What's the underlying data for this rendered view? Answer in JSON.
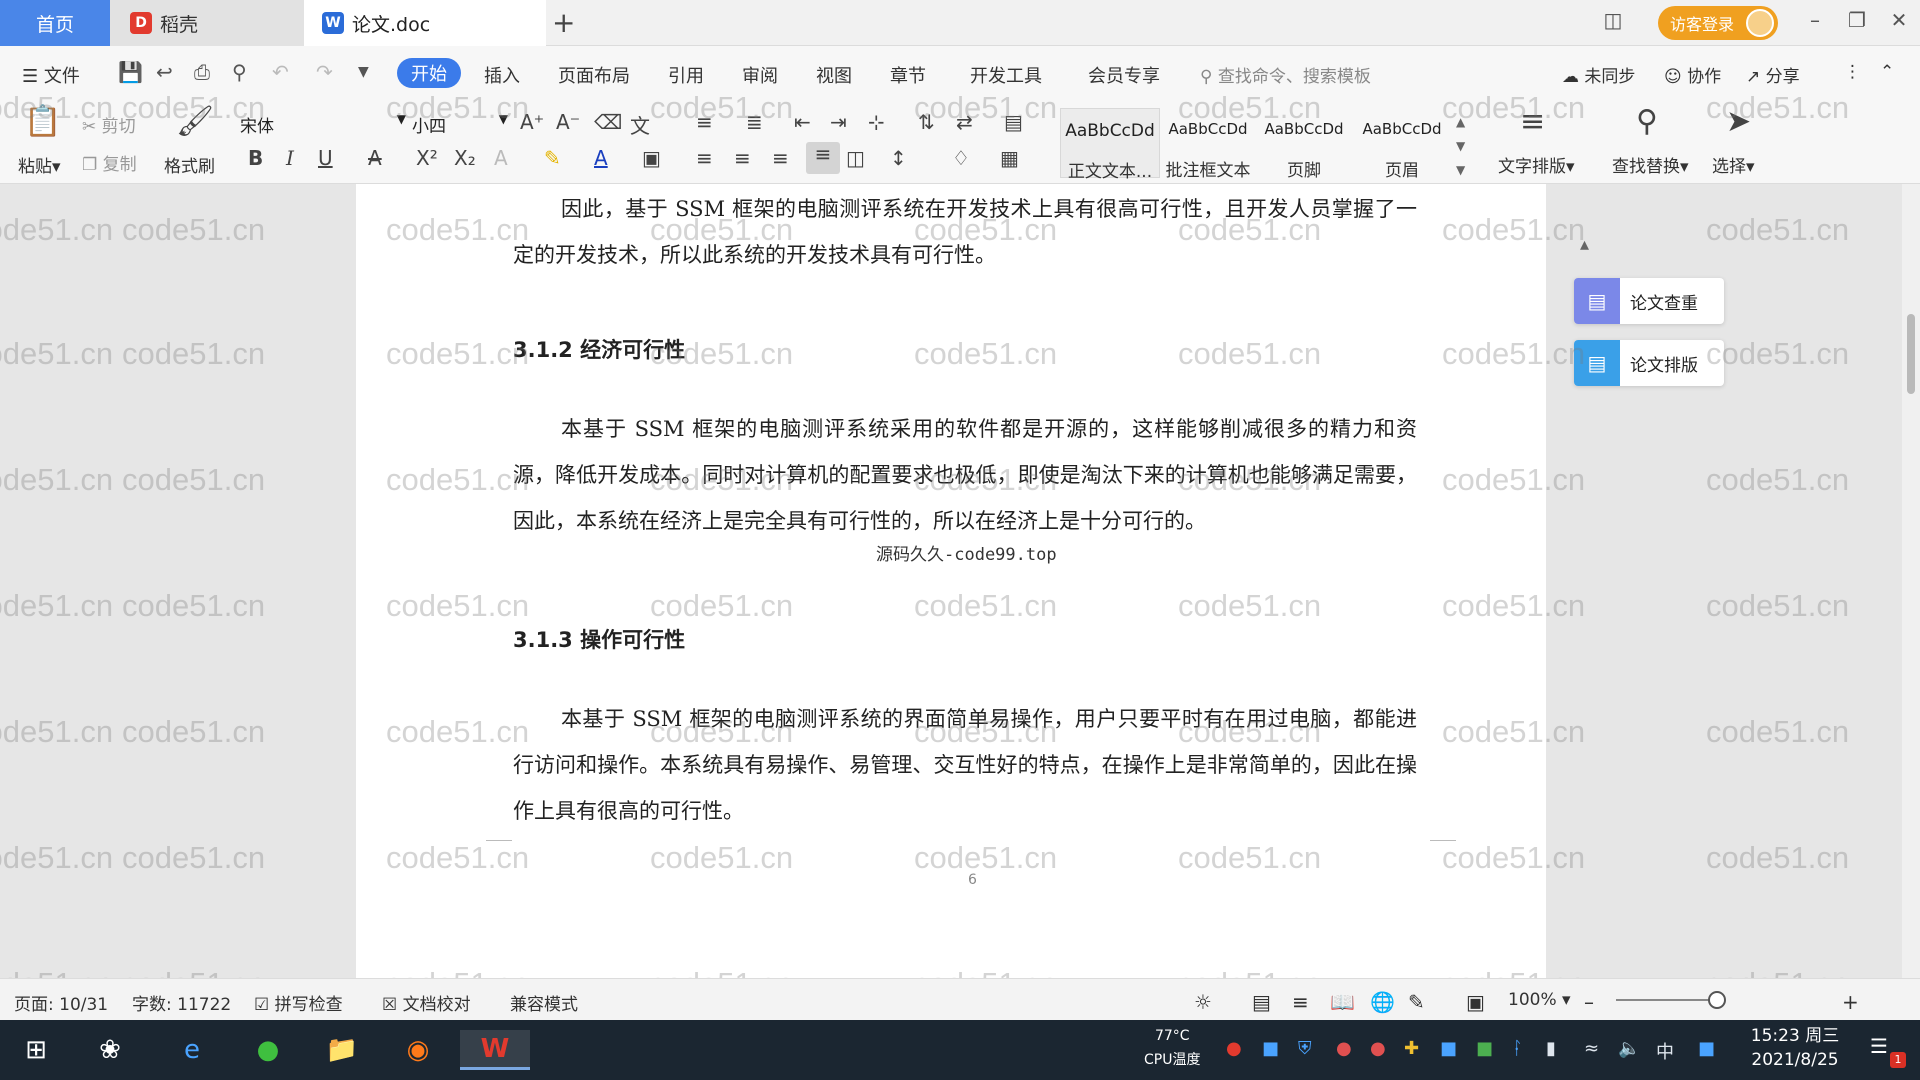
{
  "titlebar": {
    "tab_home": "首页",
    "tab_daoke": "稻壳",
    "tab_doc": "论文.doc",
    "add_tab": "+",
    "login": "访客登录"
  },
  "menubar": {
    "file": "文件",
    "items": [
      "开始",
      "插入",
      "页面布局",
      "引用",
      "审阅",
      "视图",
      "章节",
      "开发工具",
      "会员专享"
    ],
    "search_cmd": "查找命令、搜索模板",
    "sync": "未同步",
    "collab": "协作",
    "share": "分享"
  },
  "ribbon": {
    "paste": "粘贴",
    "cut": "剪切",
    "copy": "复制",
    "format_painter": "格式刷",
    "font_name": "宋体",
    "font_size": "小四",
    "styles": [
      {
        "sample": "AaBbCcDd",
        "label": "正文文本..."
      },
      {
        "sample": "AaBbCcDd",
        "label": "批注框文本"
      },
      {
        "sample": "AaBbCcDd",
        "label": "页脚"
      },
      {
        "sample": "AaBbCcDd",
        "label": "页眉"
      }
    ],
    "text_layout": "文字排版",
    "find_replace": "查找替换",
    "select": "选择"
  },
  "document": {
    "para1": "因此，基于 SSM 框架的电脑测评系统在开发技术上具有很高可行性，且开发人员掌握了一定的开发技术，所以此系统的开发技术具有可行性。",
    "heading1": "3.1.2 经济可行性",
    "para2": "本基于 SSM 框架的电脑测评系统采用的软件都是开源的，这样能够削减很多的精力和资源，降低开发成本。同时对计算机的配置要求也极低，即使是淘汰下来的计算机也能够满足需要，因此，本系统在经济上是完全具有可行性的，所以在经济上是十分可行的。",
    "overlay_text": "源码久久-code99.top",
    "heading2": "3.1.3 操作可行性",
    "para3": "本基于 SSM 框架的电脑测评系统的界面简单易操作，用户只要平时有在用过电脑，都能进行访问和操作。本系统具有易操作、易管理、交互性好的特点，在操作上是非常简单的，因此在操作上具有很高的可行性。",
    "page_number": "6",
    "watermark": "code51.cn"
  },
  "side_panel": {
    "check": "论文查重",
    "format": "论文排版"
  },
  "statusbar": {
    "page": "页面: 10/31",
    "words": "字数: 11722",
    "spell": "拼写检查",
    "proof": "文档校对",
    "compat": "兼容模式",
    "zoom": "100%"
  },
  "taskbar": {
    "cpu_temp": "77°C",
    "cpu_label": "CPU温度",
    "ime": "中",
    "time": "15:23 周三",
    "date": "2021/8/25",
    "notif_count": "1"
  },
  "colors": {
    "accent": "#3b7bea",
    "home_tab": "#4a86e8",
    "login": "#f0a020",
    "taskbar": "#1b2631"
  }
}
